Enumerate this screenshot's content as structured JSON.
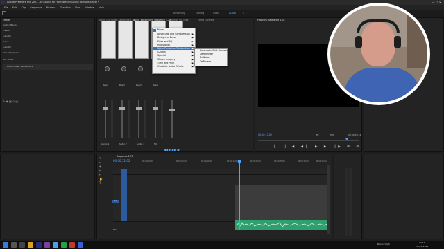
{
  "window": {
    "title": "Adobe Premiere Pro 2022 - E:\\Sound For Youtube\\prj\\Sound\\Youtube.prproj *"
  },
  "menubar": [
    "File",
    "Edit",
    "Clip",
    "Sequence",
    "Markers",
    "Graphics",
    "View",
    "Window",
    "Help"
  ],
  "workspaces": [
    "Assembly",
    "Editing",
    "Color",
    "Audio"
  ],
  "active_workspace": "Audio",
  "left_panel": {
    "tab": "Effects",
    "items": [
      "Audio Effects",
      "Presets",
      "Lumetri",
      "Video",
      "Lumetri",
      "Closed Captions"
    ],
    "bin_label": "Bin: Audio",
    "clip_name": "Audio Mixer: Sequence 1"
  },
  "center_tabs": [
    "Audio Clip Mixer: Sequence 1.78",
    "Audio Track Mixer: Sequence 1.78",
    "Source: (no clips)",
    "Effect Controls"
  ],
  "program_tab": "Program: Sequence 1.78",
  "program_timecode": "00;00;12;02",
  "program_duration": "00;00;30;12",
  "program_fit": "Fit",
  "program_zoom": "Full",
  "sequence_tab": "Sequence 1.78",
  "sequence_timecode": "00;00;12;02",
  "ruler_labels": [
    "00;00;00;00",
    "00;00;05;00",
    "00;00;10;00",
    "00;00;15;00",
    "00;00;20;00",
    "00;00;25;00",
    "00;00;30;00",
    "00;00;35;00"
  ],
  "tracks": [
    "V3",
    "V2",
    "V1",
    "A1",
    "A2",
    "A3",
    "Mix"
  ],
  "mixer": {
    "channels": [
      "Audio 1",
      "Audio 2",
      "Audio 3",
      "Mix"
    ],
    "read_labels": [
      "Read",
      "Read",
      "Read",
      "Read"
    ]
  },
  "context_menu": {
    "items": [
      "None",
      "Amplitude and Compression",
      "Delay and Echo",
      "Filter and EQ",
      "Modulation",
      "Noise Reduction/Restoration",
      "Reverb",
      "Special",
      "Stereo Imagery",
      "Time and Pitch",
      "Obsolete Audio Effects"
    ],
    "highlighted": "Noise Reduction/Restoration",
    "submenu": [
      "Automatic Click Remover",
      "DeHummer",
      "DeNoise",
      "DeReverb"
    ]
  },
  "taskbar": {
    "clock": "12:13",
    "date": "13/11/2021",
    "record_label": "Record high"
  },
  "colors": {
    "accent": "#4da3ff",
    "clip": "#2e9f6e",
    "playhead": "#4da3ff",
    "highlight": "#2f74c7"
  }
}
